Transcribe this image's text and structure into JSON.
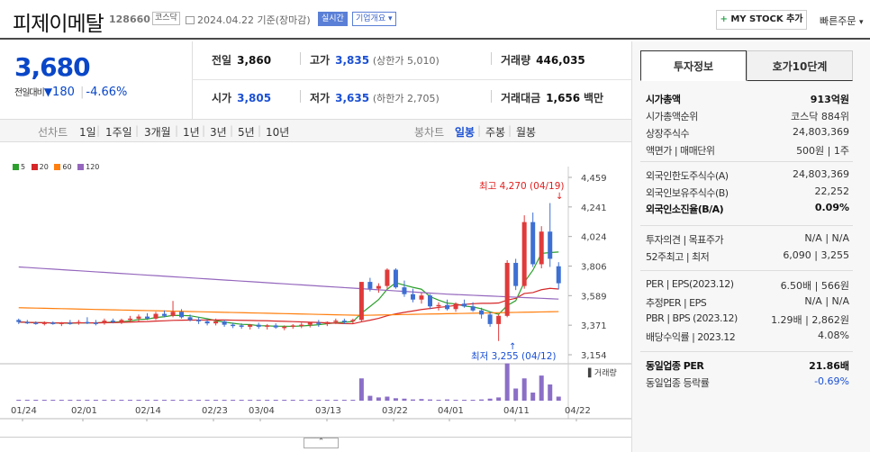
{
  "header": {
    "name": "피제이메탈",
    "code": "128660",
    "market": "코스닥",
    "date": "2024.04.22 기준(장마감)",
    "realtime": "실시간",
    "company_info": "기업개요",
    "mystock": "MY STOCK 추가",
    "quick_order": "빠른주문"
  },
  "price": {
    "current": "3,680",
    "change_label": "전일대비",
    "change": "180",
    "change_pct": "-4.66%"
  },
  "quote": {
    "prev_label": "전일",
    "prev": "3,860",
    "high_label": "고가",
    "high": "3,835",
    "upper_limit": "(상한가 5,010)",
    "volume_label": "거래량",
    "volume": "446,035",
    "open_label": "시가",
    "open": "3,805",
    "low_label": "저가",
    "low": "3,635",
    "lower_limit": "(하한가 2,705)",
    "amount_label": "거래대금",
    "amount": "1,656",
    "amount_unit": "백만"
  },
  "periods": {
    "line_label": "선차트",
    "line": [
      "1일",
      "1주일",
      "3개월",
      "1년",
      "3년",
      "5년",
      "10년"
    ],
    "candle_label": "봉차트",
    "candle": [
      "일봉",
      "주봉",
      "월봉"
    ]
  },
  "colors": {
    "ma5": "#2ca02c",
    "ma20": "#d62728",
    "ma60": "#ff7f0e",
    "ma120": "#9467bd",
    "up": "#e03a3a",
    "down": "#3d6fd3"
  },
  "chart_data": {
    "type": "line",
    "legend": [
      "5",
      "20",
      "60",
      "120"
    ],
    "y_ticks": [
      "4,459",
      "4,241",
      "4,024",
      "3,806",
      "3,589",
      "3,371",
      "3,154"
    ],
    "ylim": [
      3154,
      4459
    ],
    "x_labels": [
      "01/24",
      "02/01",
      "02/14",
      "02/23",
      "03/04",
      "03/13",
      "03/22",
      "04/01",
      "04/11",
      "04/22"
    ],
    "annotation_high": "최고 4,270 (04/19)",
    "annotation_low": "최저 3,255 (04/12)",
    "volume_label": "거래량",
    "candles": [
      [
        3410,
        3420,
        3380,
        3395
      ],
      [
        3395,
        3410,
        3380,
        3390
      ],
      [
        3390,
        3400,
        3375,
        3385
      ],
      [
        3385,
        3400,
        3370,
        3390
      ],
      [
        3390,
        3400,
        3375,
        3380
      ],
      [
        3380,
        3395,
        3365,
        3390
      ],
      [
        3390,
        3410,
        3375,
        3385
      ],
      [
        3385,
        3410,
        3375,
        3395
      ],
      [
        3395,
        3430,
        3380,
        3390
      ],
      [
        3390,
        3410,
        3370,
        3385
      ],
      [
        3385,
        3420,
        3375,
        3405
      ],
      [
        3405,
        3420,
        3385,
        3395
      ],
      [
        3395,
        3420,
        3380,
        3410
      ],
      [
        3410,
        3440,
        3390,
        3420
      ],
      [
        3420,
        3450,
        3400,
        3435
      ],
      [
        3435,
        3460,
        3410,
        3420
      ],
      [
        3420,
        3470,
        3410,
        3455
      ],
      [
        3455,
        3480,
        3430,
        3440
      ],
      [
        3440,
        3550,
        3430,
        3470
      ],
      [
        3470,
        3490,
        3420,
        3430
      ],
      [
        3430,
        3450,
        3400,
        3410
      ],
      [
        3410,
        3430,
        3380,
        3400
      ],
      [
        3400,
        3420,
        3370,
        3385
      ],
      [
        3385,
        3420,
        3370,
        3400
      ],
      [
        3400,
        3410,
        3360,
        3375
      ],
      [
        3375,
        3390,
        3350,
        3370
      ],
      [
        3370,
        3385,
        3345,
        3360
      ],
      [
        3360,
        3380,
        3340,
        3375
      ],
      [
        3375,
        3390,
        3345,
        3360
      ],
      [
        3360,
        3380,
        3340,
        3370
      ],
      [
        3370,
        3385,
        3345,
        3355
      ],
      [
        3355,
        3370,
        3335,
        3360
      ],
      [
        3360,
        3380,
        3345,
        3370
      ],
      [
        3370,
        3390,
        3350,
        3375
      ],
      [
        3375,
        3395,
        3355,
        3390
      ],
      [
        3390,
        3410,
        3360,
        3380
      ],
      [
        3380,
        3400,
        3365,
        3395
      ],
      [
        3395,
        3420,
        3380,
        3405
      ],
      [
        3405,
        3420,
        3380,
        3400
      ],
      [
        3400,
        3420,
        3385,
        3410
      ],
      [
        3410,
        3680,
        3400,
        3690
      ],
      [
        3690,
        3720,
        3620,
        3640
      ],
      [
        3640,
        3680,
        3610,
        3660
      ],
      [
        3660,
        3790,
        3640,
        3780
      ],
      [
        3780,
        3790,
        3640,
        3650
      ],
      [
        3650,
        3700,
        3580,
        3600
      ],
      [
        3600,
        3640,
        3540,
        3560
      ],
      [
        3560,
        3610,
        3530,
        3590
      ],
      [
        3590,
        3600,
        3490,
        3510
      ],
      [
        3510,
        3540,
        3480,
        3520
      ],
      [
        3520,
        3560,
        3480,
        3490
      ],
      [
        3490,
        3540,
        3470,
        3530
      ],
      [
        3530,
        3560,
        3500,
        3510
      ],
      [
        3510,
        3540,
        3470,
        3480
      ],
      [
        3480,
        3500,
        3420,
        3450
      ],
      [
        3450,
        3470,
        3360,
        3380
      ],
      [
        3380,
        3450,
        3255,
        3440
      ],
      [
        3440,
        3850,
        3430,
        3830
      ],
      [
        3830,
        3860,
        3630,
        3660
      ],
      [
        3660,
        4180,
        3640,
        4130
      ],
      [
        4130,
        4200,
        3800,
        3820
      ],
      [
        3820,
        4100,
        3790,
        4060
      ],
      [
        4060,
        4270,
        3800,
        3860
      ],
      [
        3805,
        3835,
        3635,
        3680
      ]
    ],
    "volumes": [
      0.015,
      0.01,
      0.01,
      0.012,
      0.01,
      0.01,
      0.01,
      0.012,
      0.015,
      0.01,
      0.012,
      0.01,
      0.012,
      0.015,
      0.018,
      0.012,
      0.02,
      0.012,
      0.02,
      0.012,
      0.01,
      0.01,
      0.012,
      0.01,
      0.01,
      0.01,
      0.01,
      0.01,
      0.01,
      0.01,
      0.01,
      0.01,
      0.01,
      0.01,
      0.012,
      0.01,
      0.012,
      0.015,
      0.012,
      0.015,
      0.55,
      0.12,
      0.08,
      0.1,
      0.06,
      0.05,
      0.03,
      0.04,
      0.03,
      0.02,
      0.03,
      0.02,
      0.02,
      0.02,
      0.03,
      0.05,
      0.08,
      0.92,
      0.3,
      0.55,
      0.2,
      0.62,
      0.4,
      0.1
    ]
  },
  "right": {
    "tab_info": "투자정보",
    "tab_hoga": "호가10단계",
    "rows1": [
      {
        "k": "시가총액",
        "v": "913억원",
        "bold": true
      },
      {
        "k": "시가총액순위",
        "v": "코스닥 884위"
      },
      {
        "k": "상장주식수",
        "v": "24,803,369"
      },
      {
        "k": "액면가 | 매매단위",
        "v": "500원 | 1주"
      }
    ],
    "rows2": [
      {
        "k": "외국인한도주식수(A)",
        "v": "24,803,369"
      },
      {
        "k": "외국인보유주식수(B)",
        "v": "22,252"
      },
      {
        "k": "외국인소진율(B/A)",
        "v": "0.09%",
        "bold": true
      }
    ],
    "rows3": [
      {
        "k": "투자의견 | 목표주가",
        "v": "N/A | N/A"
      },
      {
        "k": "52주최고 | 최저",
        "v": "6,090 | 3,255"
      }
    ],
    "rows4": [
      {
        "k": "PER | EPS(2023.12)",
        "v": "6.50배 | 566원"
      },
      {
        "k": "추정PER | EPS",
        "v": "N/A | N/A"
      },
      {
        "k": "PBR | BPS (2023.12)",
        "v": "1.29배 | 2,862원"
      },
      {
        "k": "배당수익률 | 2023.12",
        "v": "4.08%"
      }
    ],
    "rows5": [
      {
        "k": "동일업종 PER",
        "v": "21.86배",
        "bold": true
      },
      {
        "k": "동일업종 등락률",
        "v": "-0.69%",
        "neg": true
      }
    ]
  }
}
